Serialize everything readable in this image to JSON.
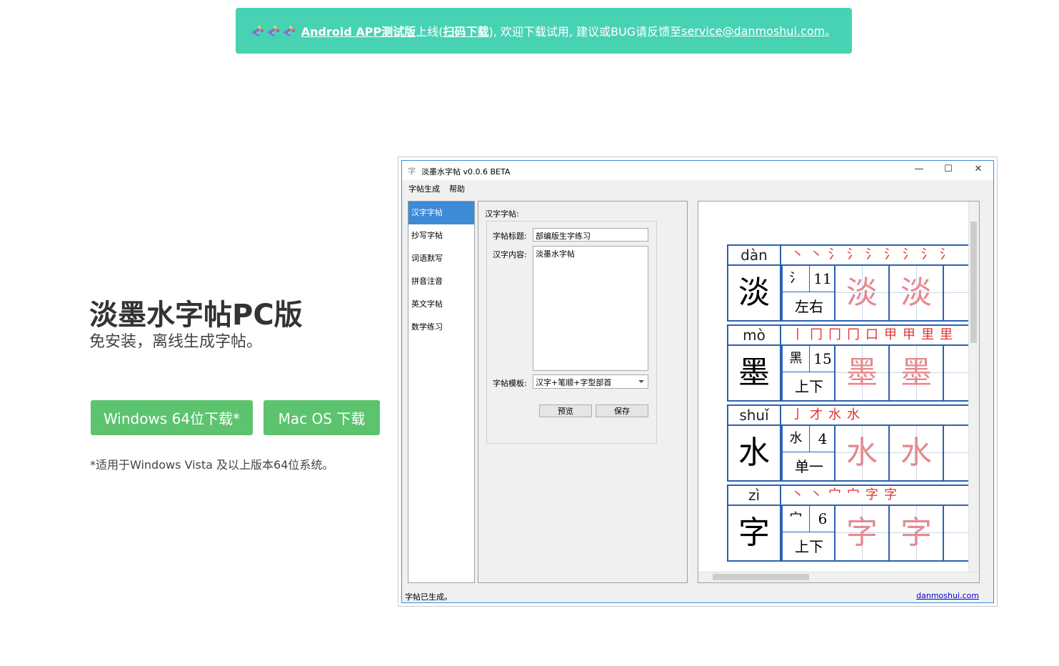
{
  "banner": {
    "emoji": [
      "party-popper",
      "party-popper",
      "party-popper"
    ],
    "link_text": "Android APP测试版",
    "text1": "上线(",
    "scan_link": "扫码下载",
    "text2": "), 欢迎下载试用, 建议或BUG请反馈至",
    "email": "service@danmoshui.com",
    "text3": "。"
  },
  "hero": {
    "title": "淡墨水字帖PC版",
    "subtitle": "免安装，离线生成字帖。",
    "windows_button": "Windows 64位下载*",
    "mac_button": "Mac OS 下载",
    "note": "*适用于Windows Vista 及以上版本64位系统。"
  },
  "app": {
    "window_title": "淡墨水字帖 v0.0.6 BETA",
    "app_icon": "字",
    "menu": [
      "字帖生成",
      "帮助"
    ],
    "sidebar": [
      "汉字字帖",
      "抄写字帖",
      "词语默写",
      "拼音注音",
      "英文字帖",
      "数学练习"
    ],
    "form": {
      "group_title": "汉字字帖:",
      "title_label": "字帖标题:",
      "title_value": "部编版生字练习",
      "content_label": "汉字内容:",
      "content_value": "淡墨水字帖",
      "template_label": "字帖模板:",
      "template_value": "汉字+笔顺+字型部首",
      "preview_button": "预览",
      "save_button": "保存"
    },
    "status_left": "字帖已生成。",
    "status_right": "danmoshui.com",
    "characters": [
      {
        "pinyin": "dàn",
        "char": "淡",
        "radical": "氵",
        "strokes": "11",
        "structure": "左右",
        "order": [
          "丶",
          "丶",
          "氵",
          "氵",
          "氵",
          "氵",
          "氵",
          "氵",
          "氵"
        ]
      },
      {
        "pinyin": "mò",
        "char": "墨",
        "radical": "黑",
        "strokes": "15",
        "structure": "上下",
        "order": [
          "丨",
          "冂",
          "冂",
          "冂",
          "口",
          "甲",
          "甲",
          "里",
          "里"
        ]
      },
      {
        "pinyin": "shuǐ",
        "char": "水",
        "radical": "水",
        "strokes": "4",
        "structure": "单一",
        "order": [
          "亅",
          "才",
          "水",
          "水"
        ]
      },
      {
        "pinyin": "zì",
        "char": "字",
        "radical": "宀",
        "strokes": "6",
        "structure": "上下",
        "order": [
          "丶",
          "丶",
          "宀",
          "宀",
          "字",
          "字"
        ]
      }
    ]
  }
}
